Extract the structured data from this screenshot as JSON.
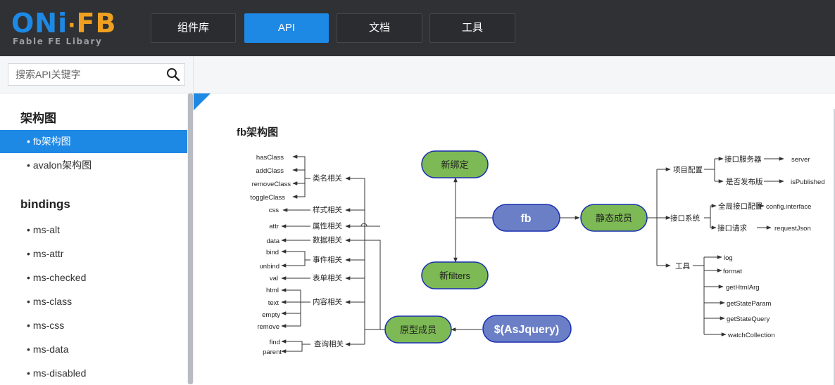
{
  "logo": {
    "main_left": "ONi",
    "main_dot": "·",
    "main_right": "FB",
    "sub": "Fable FE Libary"
  },
  "nav": [
    {
      "label": "组件库",
      "active": false
    },
    {
      "label": "API",
      "active": true
    },
    {
      "label": "文档",
      "active": false
    },
    {
      "label": "工具",
      "active": false
    }
  ],
  "search": {
    "placeholder": "搜索API关键字",
    "value": ""
  },
  "sidebar": {
    "groups": [
      {
        "heading": "架构图",
        "items": [
          {
            "label": "fb架构图",
            "active": true
          },
          {
            "label": "avalon架构图",
            "active": false
          }
        ]
      },
      {
        "heading": "bindings",
        "items": [
          {
            "label": "ms-alt"
          },
          {
            "label": "ms-attr"
          },
          {
            "label": "ms-checked"
          },
          {
            "label": "ms-class"
          },
          {
            "label": "ms-css"
          },
          {
            "label": "ms-data"
          },
          {
            "label": "ms-disabled"
          }
        ]
      }
    ],
    "bullet": "•"
  },
  "content": {
    "title": "fb架构图",
    "diagram": {
      "nodes": {
        "fb": "fb",
        "new_bind": "新绑定",
        "new_filters": "新filters",
        "static": "静态成员",
        "proto": "原型成员",
        "asjquery": "$(AsJquery)"
      },
      "proto_groups": [
        "类名相关",
        "样式相关",
        "属性相关",
        "数据相关",
        "事件相关",
        "表单相关",
        "内容相关",
        "查询相关"
      ],
      "proto_leaves": [
        "hasClass",
        "addClass",
        "removeClass",
        "toggleClass",
        "css",
        "attr",
        "data",
        "bind",
        "unbind",
        "val",
        "html",
        "text",
        "empty",
        "remove",
        "find",
        "parent"
      ],
      "static_groups": [
        "项目配置",
        "接口系统",
        "工具"
      ],
      "config_items": [
        "接口服务器",
        "是否发布版"
      ],
      "config_values": [
        "server",
        "isPublished"
      ],
      "api_items": [
        "全局接口配置",
        "接口请求"
      ],
      "api_values": [
        "config.interface",
        "requestJson"
      ],
      "tools": [
        "log",
        "format",
        "getHtmlArg",
        "getStateParam",
        "getStateQuery",
        "watchCollection"
      ]
    }
  },
  "colors": {
    "accent": "#1e88e5",
    "topbar": "#2f3134",
    "green_node": "#7db954",
    "blue_node": "#6b7fc6",
    "node_border": "#1a2fb0"
  }
}
